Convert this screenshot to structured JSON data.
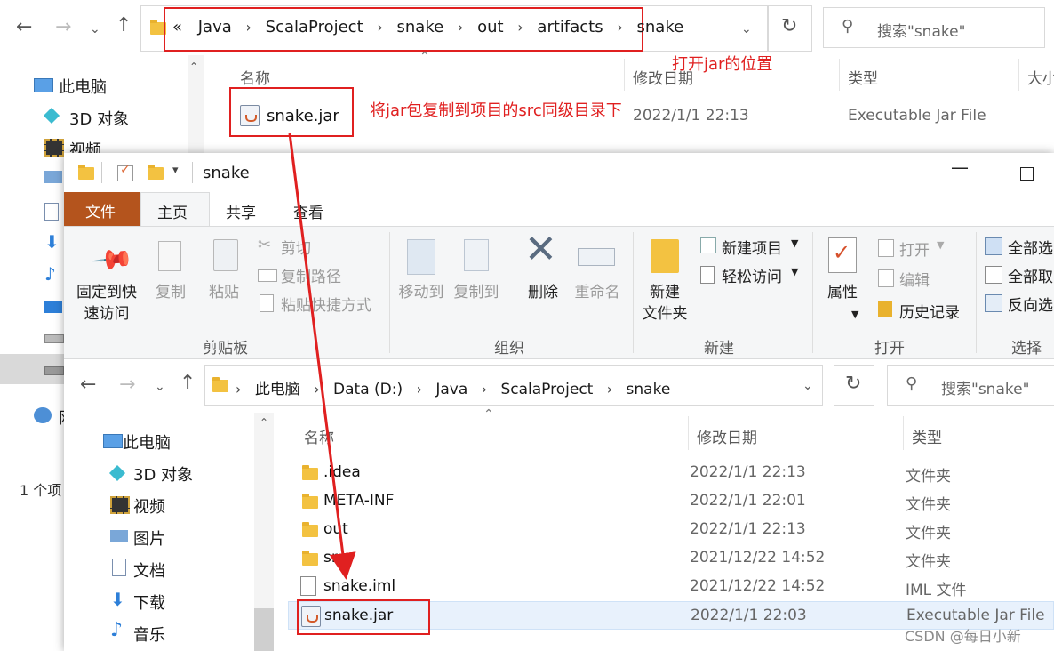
{
  "back_window": {
    "breadcrumb": [
      "«",
      "Java",
      "ScalaProject",
      "snake",
      "out",
      "artifacts",
      "snake"
    ],
    "search_placeholder": "搜索\"snake\"",
    "annotation_location": "打开jar的位置",
    "annotation_copy": "将jar包复制到项目的src同级目录下",
    "columns": {
      "name": "名称",
      "modified": "修改日期",
      "type": "类型",
      "size": "大小"
    },
    "file": {
      "name": "snake.jar",
      "modified": "2022/1/1 22:13",
      "type": "Executable Jar File"
    },
    "nav": [
      "此电脑",
      "3D 对象",
      "视频"
    ],
    "nav_partial": "网",
    "status": "1 个项"
  },
  "front_window": {
    "title": "snake",
    "tabs": [
      "文件",
      "主页",
      "共享",
      "查看"
    ],
    "ribbon": {
      "clipboard": {
        "pin": "固定到快\n速访问",
        "copy": "复制",
        "paste": "粘贴",
        "cut": "剪切",
        "copy_path": "复制路径",
        "paste_shortcut": "粘贴快捷方式",
        "group": "剪贴板"
      },
      "organize": {
        "move_to": "移动到",
        "copy_to": "复制到",
        "delete": "删除",
        "rename": "重命名",
        "group": "组织"
      },
      "new": {
        "new_folder": "新建\n文件夹",
        "new_item": "新建项目",
        "easy_access": "轻松访问",
        "group": "新建"
      },
      "open": {
        "properties": "属性",
        "open": "打开",
        "edit": "编辑",
        "history": "历史记录",
        "group": "打开"
      },
      "select": {
        "select_all": "全部选",
        "select_none": "全部取",
        "invert": "反向选",
        "group": "选择"
      }
    },
    "breadcrumb": [
      "此电脑",
      "Data (D:)",
      "Java",
      "ScalaProject",
      "snake"
    ],
    "search_placeholder": "搜索\"snake\"",
    "columns": {
      "name": "名称",
      "modified": "修改日期",
      "type": "类型"
    },
    "nav": [
      "此电脑",
      "3D 对象",
      "视频",
      "图片",
      "文档",
      "下载",
      "音乐"
    ],
    "files": [
      {
        "name": ".idea",
        "modified": "2022/1/1 22:13",
        "type": "文件夹",
        "icon": "folder-icon"
      },
      {
        "name": "META-INF",
        "modified": "2022/1/1 22:01",
        "type": "文件夹",
        "icon": "folder-icon"
      },
      {
        "name": "out",
        "modified": "2022/1/1 22:13",
        "type": "文件夹",
        "icon": "folder-icon"
      },
      {
        "name": "src",
        "modified": "2021/12/22 14:52",
        "type": "文件夹",
        "icon": "folder-icon"
      },
      {
        "name": "snake.iml",
        "modified": "2021/12/22 14:52",
        "type": "IML 文件",
        "icon": "document-icon"
      },
      {
        "name": "snake.jar",
        "modified": "2022/1/1 22:03",
        "type": "Executable Jar File",
        "icon": "jar-icon"
      }
    ]
  },
  "watermark": "CSDN @每日小新",
  "colors": {
    "accent_red": "#e02020",
    "file_tab": "#b4541d",
    "selection": "#e8f1fc"
  }
}
